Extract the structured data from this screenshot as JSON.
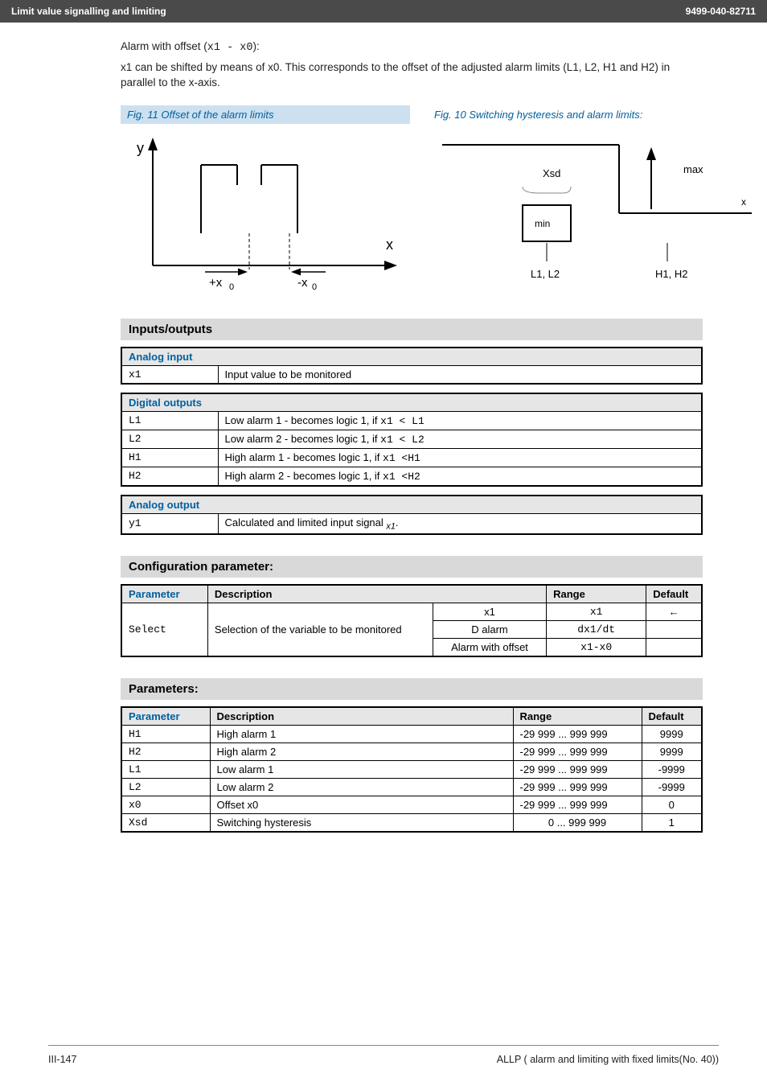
{
  "header": {
    "left": "Limit value signalling and limiting",
    "right": "9499-040-82711"
  },
  "intro": {
    "line1a": "Alarm with offset (",
    "line1b": "):",
    "offset_expr": "x1  -  x0",
    "line2": "x1 can be shifted by means of x0. This corresponds to the offset of the adjusted alarm limits (L1, L2, H1 and  H2) in parallel to the x-axis."
  },
  "figs": {
    "cap11": "Fig. 11  Offset of  the alarm limits",
    "cap10": "Fig. 10  Switching hysteresis and alarm limits:",
    "y": "y",
    "xlabel": "x",
    "xplus": "+x",
    "xminus": "-x",
    "zero": "0",
    "xsd": "Xsd",
    "max": "max",
    "min": "min",
    "L1L2": "L1, L2",
    "H1H2": "H1, H2"
  },
  "sections": {
    "io": "Inputs/outputs",
    "config": "Configuration parameter:",
    "params": "Parameters:"
  },
  "analog_input": {
    "title": "Analog input",
    "row": {
      "key": "x1",
      "desc": "Input value to be monitored"
    }
  },
  "digital_outputs": {
    "title": "Digital outputs",
    "rows": [
      {
        "key": "L1",
        "pre": "Low alarm 1 - becomes logic 1, if ",
        "cond": "x1 < L1"
      },
      {
        "key": "L2",
        "pre": "Low alarm 2  - becomes logic 1, if ",
        "cond": "x1 < L2"
      },
      {
        "key": "H1",
        "pre": "High alarm 1  - becomes logic 1, if ",
        "cond": "x1 <H1"
      },
      {
        "key": "H2",
        "pre": "High alarm 2  - becomes logic 1, if ",
        "cond": "x1 <H2"
      }
    ]
  },
  "analog_output": {
    "title": "Analog output",
    "row": {
      "key": "y1",
      "desc": "Calculated and limited input signal ",
      "sub": "x1"
    }
  },
  "config_tbl": {
    "headers": {
      "param": "Parameter",
      "desc": "Description",
      "range": "Range",
      "def": "Default"
    },
    "param": "Select",
    "desc": "Selection of the variable to be monitored",
    "rows": [
      {
        "opt": "x1",
        "range": "x1",
        "def": "←"
      },
      {
        "opt": "D alarm",
        "range": "dx1/dt",
        "def": ""
      },
      {
        "opt": "Alarm with offset",
        "range": "x1-x0",
        "def": ""
      }
    ]
  },
  "param_tbl": {
    "headers": {
      "param": "Parameter",
      "desc": "Description",
      "range": "Range",
      "def": "Default"
    },
    "rows": [
      {
        "key": "H1",
        "desc": "High alarm 1",
        "range": "-29 999 ... 999 999",
        "def": "9999"
      },
      {
        "key": "H2",
        "desc": "High alarm 2",
        "range": "-29 999 ... 999 999",
        "def": "9999"
      },
      {
        "key": "L1",
        "desc": "Low alarm 1",
        "range": "-29 999 ... 999 999",
        "def": "-9999"
      },
      {
        "key": "L2",
        "desc": "Low alarm 2",
        "range": "-29 999 ... 999 999",
        "def": "-9999"
      },
      {
        "key": "x0",
        "desc": "Offset x0",
        "range": "-29 999 ... 999 999",
        "def": "0"
      },
      {
        "key": "Xsd",
        "desc": "Switching hysteresis",
        "range": "0 ... 999 999",
        "def": "1"
      }
    ]
  },
  "footer": {
    "left": "III-147",
    "right": "ALLP ( alarm and limiting with fixed limits(No. 40))"
  }
}
